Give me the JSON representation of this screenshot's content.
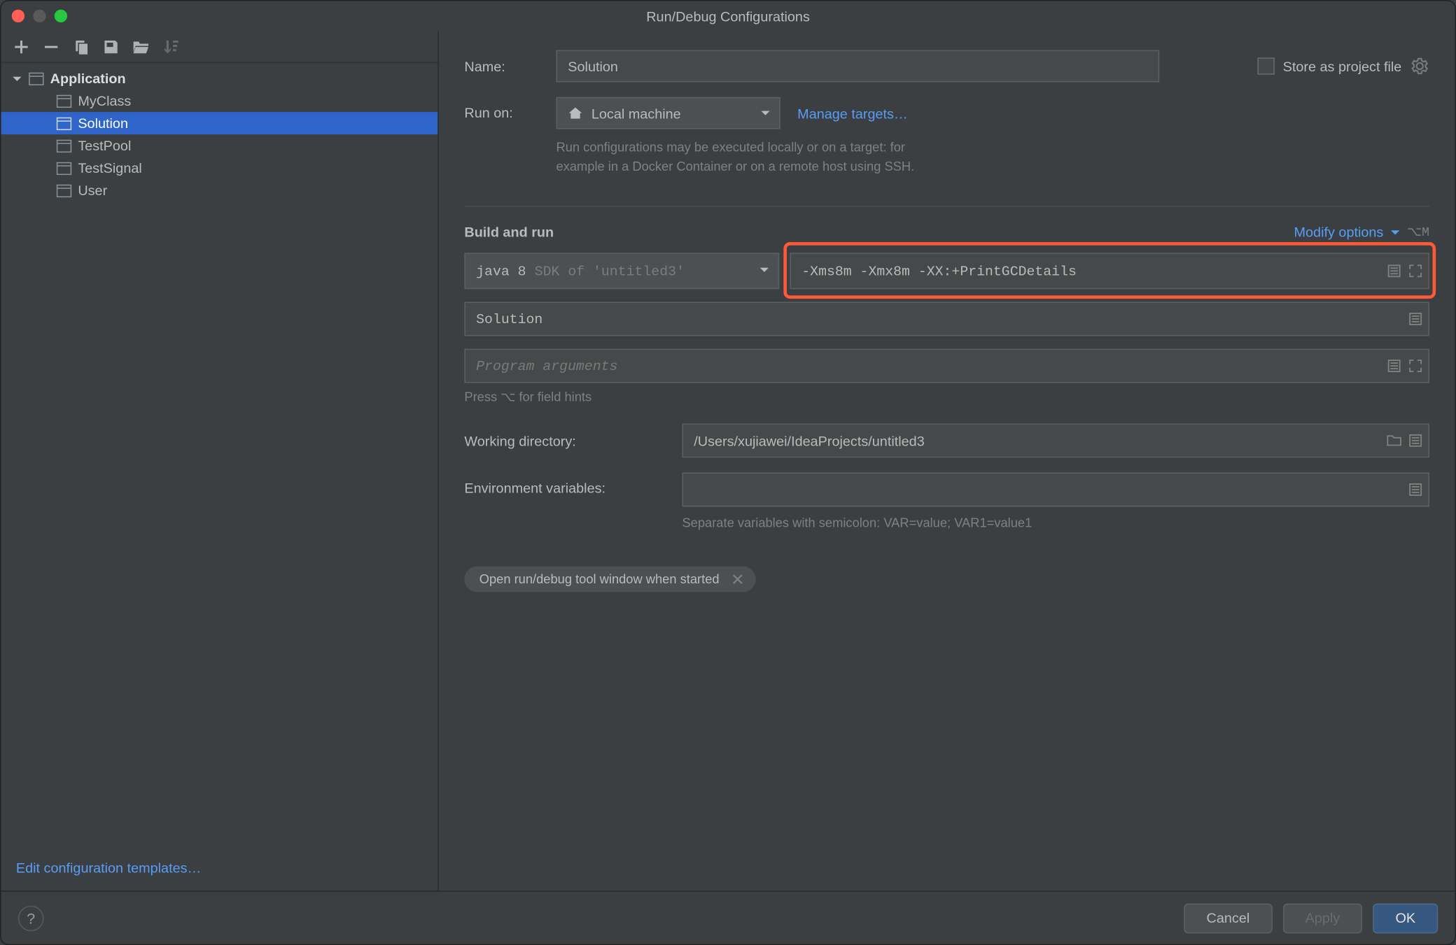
{
  "title": "Run/Debug Configurations",
  "sidebar": {
    "category": "Application",
    "items": [
      "MyClass",
      "Solution",
      "TestPool",
      "TestSignal",
      "User"
    ],
    "selected_index": 1,
    "edit_templates": "Edit configuration templates…"
  },
  "form": {
    "name_label": "Name:",
    "name_value": "Solution",
    "store_as_file": "Store as project file",
    "run_on_label": "Run on:",
    "run_on_value": "Local machine",
    "manage_targets": "Manage targets…",
    "run_on_help1": "Run configurations may be executed locally or on a target: for",
    "run_on_help2": "example in a Docker Container or on a remote host using SSH.",
    "build_run_title": "Build and run",
    "modify_options": "Modify options",
    "modify_shortcut": "⌥M",
    "jdk_main": "java 8",
    "jdk_hint": "SDK of 'untitled3'",
    "vm_options": "-Xms8m -Xmx8m -XX:+PrintGCDetails",
    "main_class": "Solution",
    "program_args_placeholder": "Program arguments",
    "field_hints": "Press ⌥ for field hints",
    "working_dir_label": "Working directory:",
    "working_dir_value": "/Users/xujiawei/IdeaProjects/untitled3",
    "env_label": "Environment variables:",
    "env_value": "",
    "env_help": "Separate variables with semicolon: VAR=value; VAR1=value1",
    "chip_label": "Open run/debug tool window when started"
  },
  "buttons": {
    "cancel": "Cancel",
    "apply": "Apply",
    "ok": "OK"
  }
}
